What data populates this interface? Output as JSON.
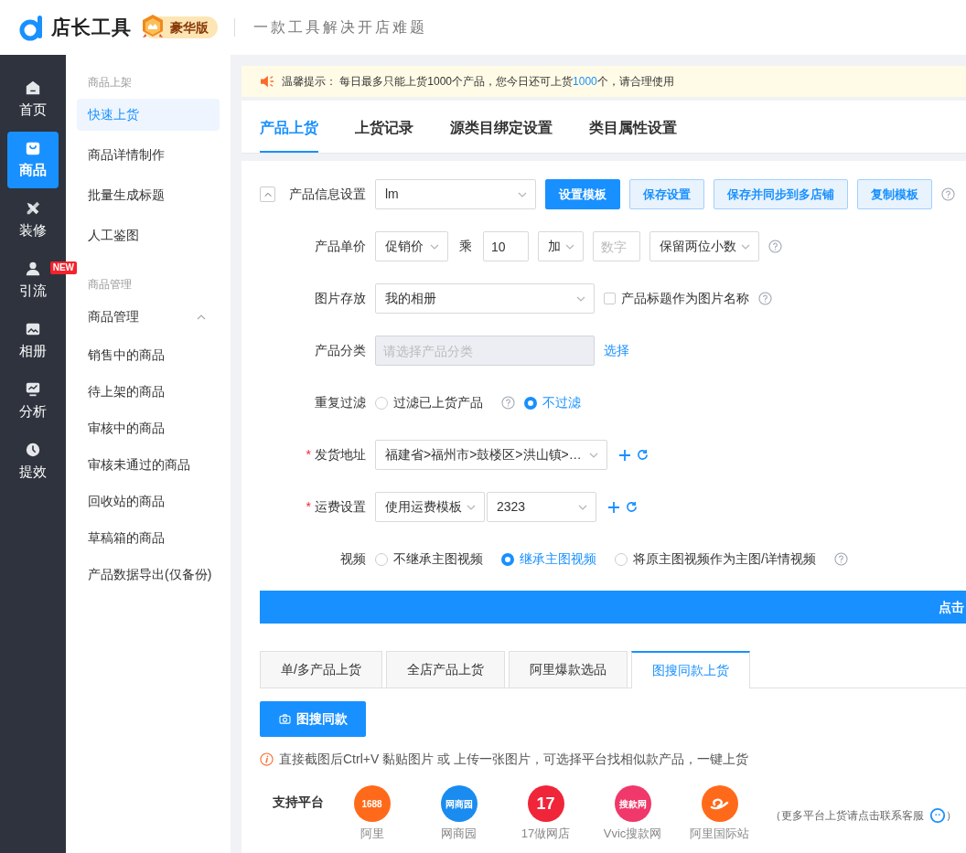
{
  "header": {
    "brand": "店长工具",
    "badge": "豪华版",
    "slogan": "一款工具解决开店难题"
  },
  "nav": [
    {
      "label": "首页",
      "selected": false
    },
    {
      "label": "商品",
      "selected": true
    },
    {
      "label": "装修",
      "selected": false
    },
    {
      "label": "引流",
      "selected": false,
      "badge": "NEW"
    },
    {
      "label": "相册",
      "selected": false
    },
    {
      "label": "分析",
      "selected": false
    },
    {
      "label": "提效",
      "selected": false
    }
  ],
  "submenu": [
    {
      "title": "商品上架",
      "items": [
        {
          "label": "快速上货",
          "selected": true
        },
        {
          "label": "商品详情制作",
          "selected": false
        },
        {
          "label": "批量生成标题",
          "selected": false
        },
        {
          "label": "人工鉴图",
          "selected": false
        }
      ]
    },
    {
      "title": "商品管理",
      "items": [
        {
          "label": "商品管理",
          "selected": false,
          "expanded": true,
          "children": [
            {
              "label": "销售中的商品",
              "selected": false
            },
            {
              "label": "待上架的商品",
              "selected": false
            },
            {
              "label": "审核中的商品",
              "selected": false
            },
            {
              "label": "审核未通过的商品",
              "selected": false
            },
            {
              "label": "回收站的商品",
              "selected": false
            },
            {
              "label": "草稿箱的商品",
              "selected": false
            },
            {
              "label": "产品数据导出(仅备份)",
              "selected": false
            }
          ]
        }
      ]
    }
  ],
  "notice": {
    "label": "温馨提示：",
    "text": "每日最多只能上货1000个产品，您今日还可上货",
    "count": "1000",
    "suffix": "个，请合理使用"
  },
  "tabs": [
    {
      "label": "产品上货",
      "selected": true
    },
    {
      "label": "上货记录",
      "selected": false
    },
    {
      "label": "源类目绑定设置",
      "selected": false
    },
    {
      "label": "类目属性设置",
      "selected": false
    }
  ],
  "form": [
    {
      "label": "产品信息设置",
      "collapse": true,
      "controls": [
        {
          "kind": "select",
          "value": "lm"
        },
        {
          "kind": "button",
          "label": "设置模板",
          "primary": true
        },
        {
          "kind": "button",
          "label": "保存设置",
          "primary": false
        },
        {
          "kind": "button",
          "label": "保存并同步到多店铺",
          "primary": false
        },
        {
          "kind": "button",
          "label": "复制模板",
          "primary": false
        },
        {
          "kind": "help"
        }
      ]
    },
    {
      "label": "产品单价",
      "controls": [
        {
          "kind": "select",
          "value": "促销价"
        },
        {
          "kind": "text",
          "label": "乘"
        },
        {
          "kind": "input",
          "value": "10"
        },
        {
          "kind": "select",
          "value": "加"
        },
        {
          "kind": "input",
          "placeholder": "数字"
        },
        {
          "kind": "select",
          "value": "保留两位小数"
        },
        {
          "kind": "help"
        }
      ]
    },
    {
      "label": "图片存放",
      "controls": [
        {
          "kind": "select",
          "value": "我的相册"
        },
        {
          "kind": "checkbox",
          "label": "产品标题作为图片名称",
          "checked": false
        },
        {
          "kind": "help"
        }
      ]
    },
    {
      "label": "产品分类",
      "controls": [
        {
          "kind": "input",
          "placeholder": "请选择产品分类",
          "disabled": true
        },
        {
          "kind": "link",
          "label": "选择"
        }
      ]
    },
    {
      "label": "重复过滤",
      "controls": [
        {
          "kind": "radio",
          "label": "过滤已上货产品",
          "selected": false
        },
        {
          "kind": "help"
        },
        {
          "kind": "radio",
          "label": "不过滤",
          "selected": true
        }
      ]
    },
    {
      "label": "发货地址",
      "required_mark": "*",
      "controls": [
        {
          "kind": "select",
          "value": "福建省>福州市>鼓楼区>洪山镇>…"
        },
        {
          "kind": "add"
        },
        {
          "kind": "refresh"
        }
      ]
    },
    {
      "label": "运费设置",
      "required_mark": "*",
      "controls": [
        {
          "kind": "select",
          "value": "使用运费模板"
        },
        {
          "kind": "select",
          "value": "2323"
        },
        {
          "kind": "add"
        },
        {
          "kind": "refresh"
        }
      ]
    },
    {
      "label": "视频",
      "controls": [
        {
          "kind": "radio",
          "label": "不继承主图视频",
          "selected": false
        },
        {
          "kind": "radio",
          "label": "继承主图视频",
          "selected": true
        },
        {
          "kind": "radio",
          "label": "将原主图视频作为主图/详情视频",
          "selected": false
        },
        {
          "kind": "help"
        }
      ]
    }
  ],
  "submit_bar": {
    "label": "点击"
  },
  "upload_tabs": [
    {
      "label": "单/多产品上货",
      "selected": false
    },
    {
      "label": "全店产品上货",
      "selected": false
    },
    {
      "label": "阿里爆款选品",
      "selected": false
    },
    {
      "label": "图搜同款上货",
      "selected": true
    }
  ],
  "search_button": {
    "label": "图搜同款"
  },
  "hint": "直接截图后Ctrl+V 黏贴图片 或 上传一张图片，可选择平台找相似款产品，一键上货",
  "platforms": {
    "label": "支持平台",
    "items": [
      {
        "name": "阿里",
        "logo_text": "1688",
        "color": "#ff6a1a"
      },
      {
        "name": "网商园",
        "logo_text": "网商园",
        "color": "#1a8cf0"
      },
      {
        "name": "17做网店",
        "logo_text": "17",
        "color": "#f0253a"
      },
      {
        "name": "Vvic搜款网",
        "logo_text": "搜款网",
        "color": "#f0386a"
      },
      {
        "name": "阿里国际站",
        "color": "#ff6a1a"
      }
    ],
    "note": "（更多平台上货请点击联系客服",
    "note_end": "）"
  }
}
